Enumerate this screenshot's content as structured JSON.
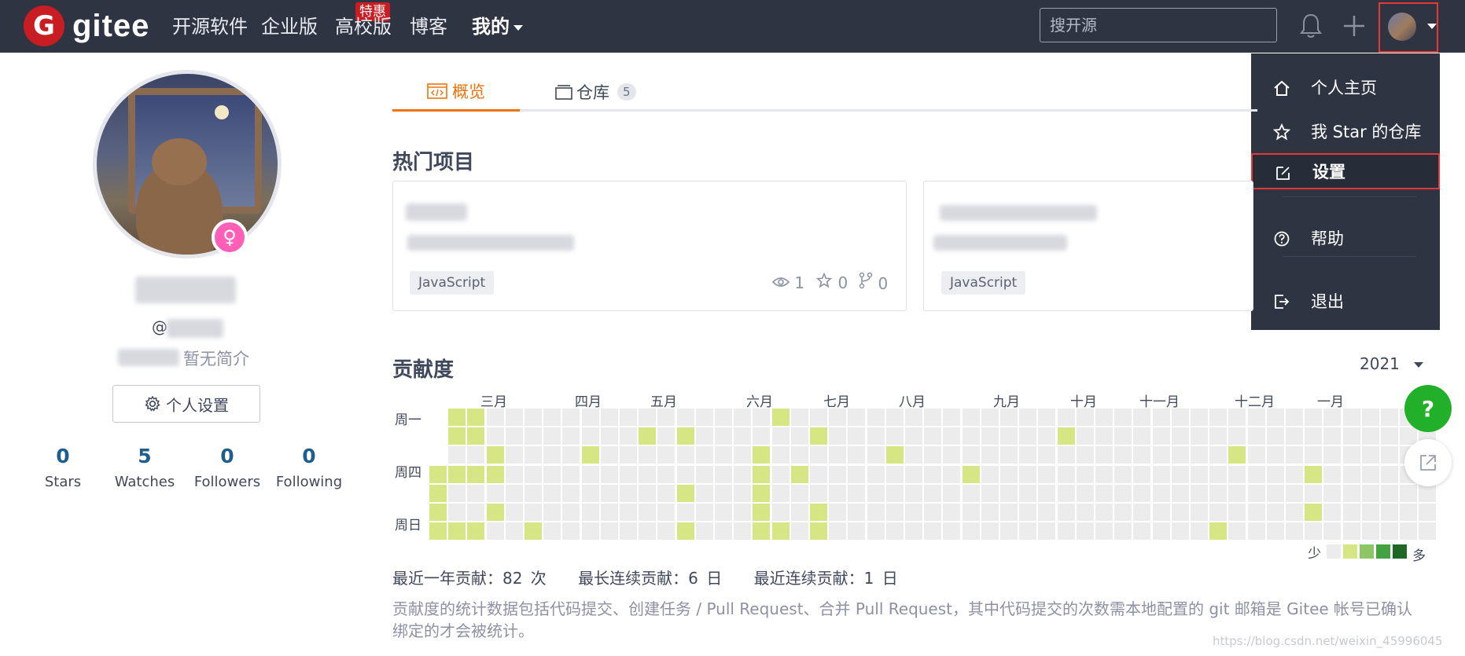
{
  "header": {
    "logo_text": "gitee",
    "nav": [
      {
        "label": "开源软件"
      },
      {
        "label": "企业版"
      },
      {
        "label": "高校版"
      },
      {
        "label": "博客"
      },
      {
        "label": "我的"
      }
    ],
    "promo_badge": "特惠",
    "search_placeholder": "搜开源"
  },
  "dropdown": {
    "items": [
      {
        "label": "个人主页",
        "icon": "home-icon"
      },
      {
        "label": "我 Star 的仓库",
        "icon": "star-icon"
      },
      {
        "label": "设置",
        "icon": "edit-icon"
      },
      {
        "label": "帮助",
        "icon": "help-icon"
      },
      {
        "label": "退出",
        "icon": "logout-icon"
      }
    ]
  },
  "profile": {
    "userid_prefix": "@",
    "bio": "暂无简介",
    "settings_button": "个人设置",
    "stats": [
      {
        "value": "0",
        "label": "Stars"
      },
      {
        "value": "5",
        "label": "Watches"
      },
      {
        "value": "0",
        "label": "Followers"
      },
      {
        "value": "0",
        "label": "Following"
      }
    ]
  },
  "tabs": [
    {
      "label": "概览"
    },
    {
      "label": "仓库",
      "count": "5"
    }
  ],
  "projects": {
    "title": "热门项目",
    "cards": [
      {
        "lang": "JavaScript",
        "watches": "1",
        "stars": "0",
        "forks": "0"
      },
      {
        "lang": "JavaScript"
      }
    ]
  },
  "contribution": {
    "title": "贡献度",
    "year": "2021",
    "months": [
      "三月",
      "四月",
      "五月",
      "六月",
      "七月",
      "八月",
      "九月",
      "十月",
      "十一月",
      "十二月",
      "一月"
    ],
    "weekdays": [
      "周一",
      "周四",
      "周日"
    ],
    "legend_less": "少",
    "legend_more": "多",
    "legend_colors": [
      "#ececec",
      "#d6e685",
      "#8cc665",
      "#44a340",
      "#1e6823"
    ],
    "active_color": "#d6e685",
    "summary": [
      "最近一年贡献：82 次",
      "最长连续贡献：6 日",
      "最近连续贡献：1 日"
    ],
    "note": "贡献度的统计数据包括代码提交、创建任务 / Pull Request、合并 Pull Request，其中代码提交的次数需本地配置的 git 邮箱是 Gitee 帐号已确认绑定的才会被统计。"
  },
  "fab": {
    "help_label": "?"
  },
  "watermark": "https://blog.csdn.net/weixin_45996045"
}
